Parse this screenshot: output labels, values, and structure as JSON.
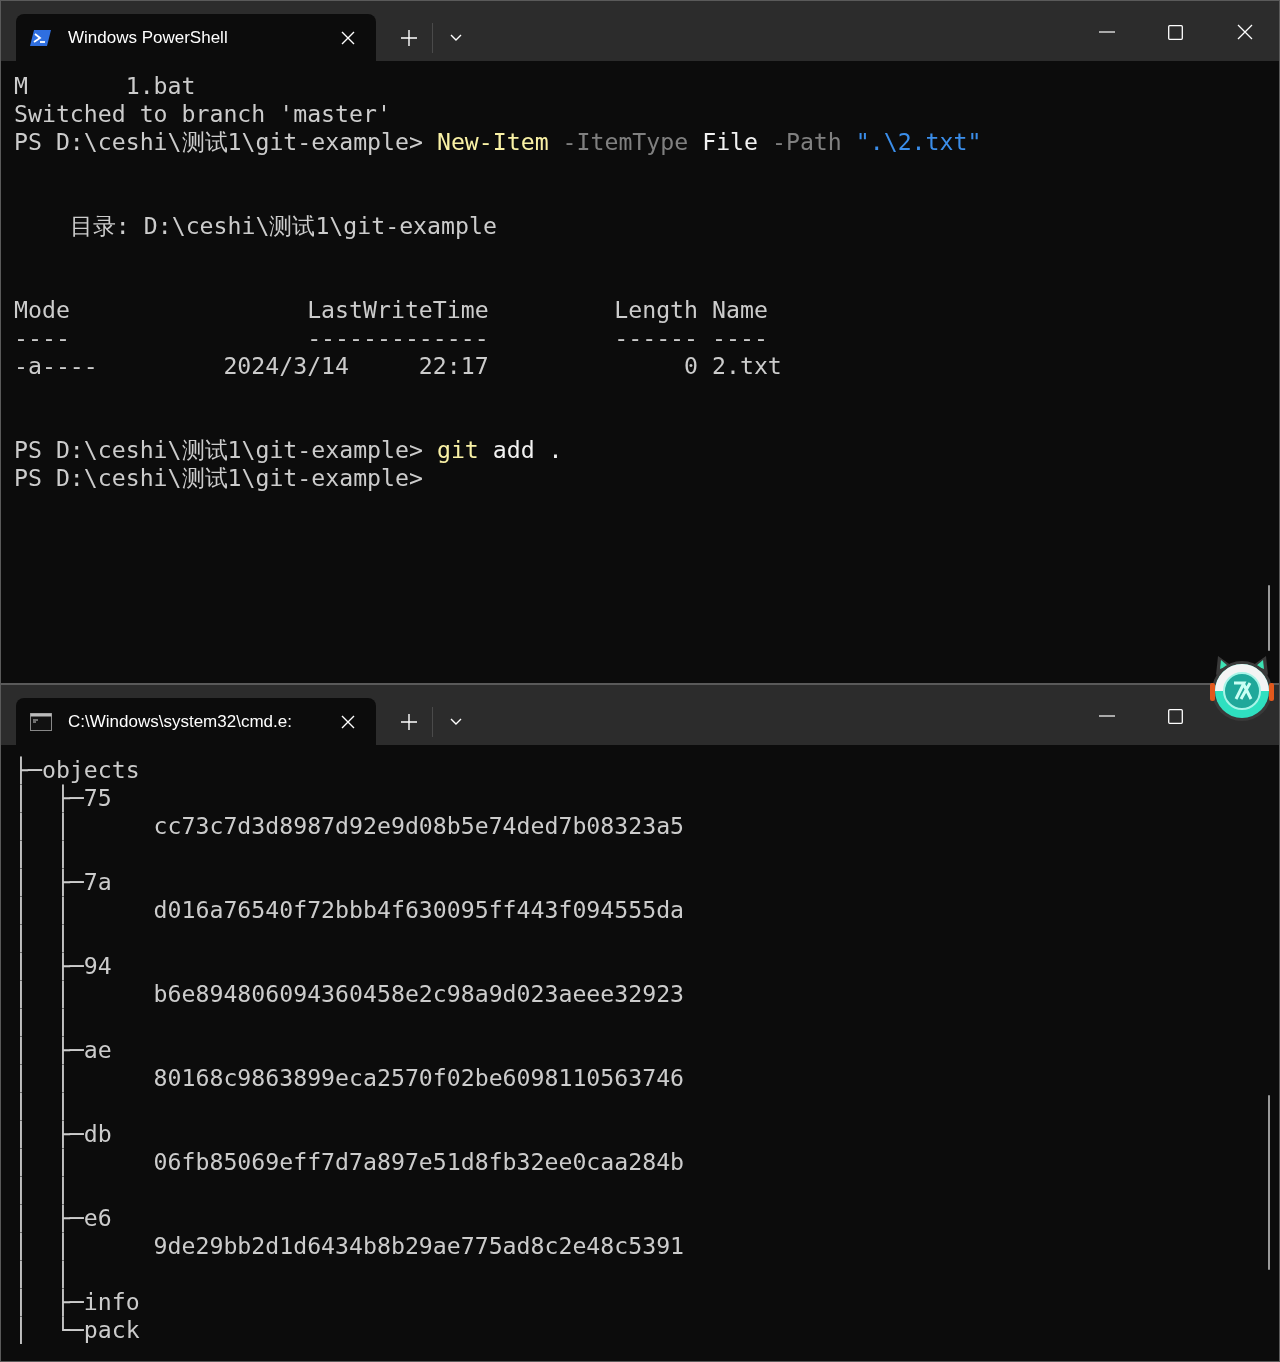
{
  "windows": [
    {
      "tab": {
        "title": "Windows PowerShell",
        "kind": "powershell",
        "selected": true
      },
      "lines": [
        {
          "kind": "text",
          "spans": [
            {
              "text": "M       1.bat",
              "kind": "output"
            }
          ]
        },
        {
          "kind": "text",
          "spans": [
            {
              "text": "Switched to branch 'master'",
              "kind": "output"
            }
          ]
        },
        {
          "kind": "text",
          "spans": [
            {
              "text": "PS D:\\ceshi\\测试1\\git-example> ",
              "kind": "output"
            },
            {
              "text": "New-Item",
              "kind": "command"
            },
            {
              "text": " -ItemType",
              "kind": "parameter"
            },
            {
              "text": " File",
              "kind": "argument"
            },
            {
              "text": " -Path",
              "kind": "parameter"
            },
            {
              "text": " \".\\2.txt\"",
              "kind": "string"
            }
          ]
        },
        {
          "kind": "blank"
        },
        {
          "kind": "blank"
        },
        {
          "kind": "text",
          "spans": [
            {
              "text": "    目录: D:\\ceshi\\测试1\\git-example",
              "kind": "output"
            }
          ]
        },
        {
          "kind": "blank"
        },
        {
          "kind": "blank"
        },
        {
          "kind": "text",
          "spans": [
            {
              "text": "Mode                 LastWriteTime         Length Name",
              "kind": "output"
            }
          ]
        },
        {
          "kind": "text",
          "spans": [
            {
              "text": "----                 -------------         ------ ----",
              "kind": "output"
            }
          ]
        },
        {
          "kind": "text",
          "spans": [
            {
              "text": "-a----         2024/3/14     22:17              0 2.txt",
              "kind": "output"
            }
          ]
        },
        {
          "kind": "blank"
        },
        {
          "kind": "blank"
        },
        {
          "kind": "text",
          "spans": [
            {
              "text": "PS D:\\ceshi\\测试1\\git-example> ",
              "kind": "output"
            },
            {
              "text": "git",
              "kind": "command"
            },
            {
              "text": " add .",
              "kind": "argument"
            }
          ]
        },
        {
          "kind": "text",
          "spans": [
            {
              "text": "PS D:\\ceshi\\测试1\\git-example>",
              "kind": "output"
            }
          ]
        }
      ]
    },
    {
      "tab": {
        "title": "C:\\Windows\\system32\\cmd.e:",
        "kind": "cmd",
        "selected": true
      },
      "lines": [
        {
          "kind": "text",
          "spans": [
            {
              "text": "├─objects",
              "kind": "output"
            }
          ]
        },
        {
          "kind": "text",
          "spans": [
            {
              "text": "│  ├─75",
              "kind": "output"
            }
          ]
        },
        {
          "kind": "text",
          "spans": [
            {
              "text": "│  │      cc73c7d3d8987d92e9d08b5e74ded7b08323a5",
              "kind": "output"
            }
          ]
        },
        {
          "kind": "text",
          "spans": [
            {
              "text": "│  │",
              "kind": "output"
            }
          ]
        },
        {
          "kind": "text",
          "spans": [
            {
              "text": "│  ├─7a",
              "kind": "output"
            }
          ]
        },
        {
          "kind": "text",
          "spans": [
            {
              "text": "│  │      d016a76540f72bbb4f630095ff443f094555da",
              "kind": "output"
            }
          ]
        },
        {
          "kind": "text",
          "spans": [
            {
              "text": "│  │",
              "kind": "output"
            }
          ]
        },
        {
          "kind": "text",
          "spans": [
            {
              "text": "│  ├─94",
              "kind": "output"
            }
          ]
        },
        {
          "kind": "text",
          "spans": [
            {
              "text": "│  │      b6e894806094360458e2c98a9d023aeee32923",
              "kind": "output"
            }
          ]
        },
        {
          "kind": "text",
          "spans": [
            {
              "text": "│  │",
              "kind": "output"
            }
          ]
        },
        {
          "kind": "text",
          "spans": [
            {
              "text": "│  ├─ae",
              "kind": "output"
            }
          ]
        },
        {
          "kind": "text",
          "spans": [
            {
              "text": "│  │      80168c9863899eca2570f02be6098110563746",
              "kind": "output"
            }
          ]
        },
        {
          "kind": "text",
          "spans": [
            {
              "text": "│  │",
              "kind": "output"
            }
          ]
        },
        {
          "kind": "text",
          "spans": [
            {
              "text": "│  ├─db",
              "kind": "output"
            }
          ]
        },
        {
          "kind": "text",
          "spans": [
            {
              "text": "│  │      06fb85069eff7d7a897e51d8fb32ee0caa284b",
              "kind": "output"
            }
          ]
        },
        {
          "kind": "text",
          "spans": [
            {
              "text": "│  │",
              "kind": "output"
            }
          ]
        },
        {
          "kind": "text",
          "spans": [
            {
              "text": "│  ├─e6",
              "kind": "output"
            }
          ]
        },
        {
          "kind": "text",
          "spans": [
            {
              "text": "│  │      9de29bb2d1d6434b8b29ae775ad8c2e48c5391",
              "kind": "output"
            }
          ]
        },
        {
          "kind": "text",
          "spans": [
            {
              "text": "│  │",
              "kind": "output"
            }
          ]
        },
        {
          "kind": "text",
          "spans": [
            {
              "text": "│  ├─info",
              "kind": "output"
            }
          ]
        },
        {
          "kind": "text",
          "spans": [
            {
              "text": "│  └─pack",
              "kind": "output"
            }
          ]
        }
      ]
    }
  ]
}
